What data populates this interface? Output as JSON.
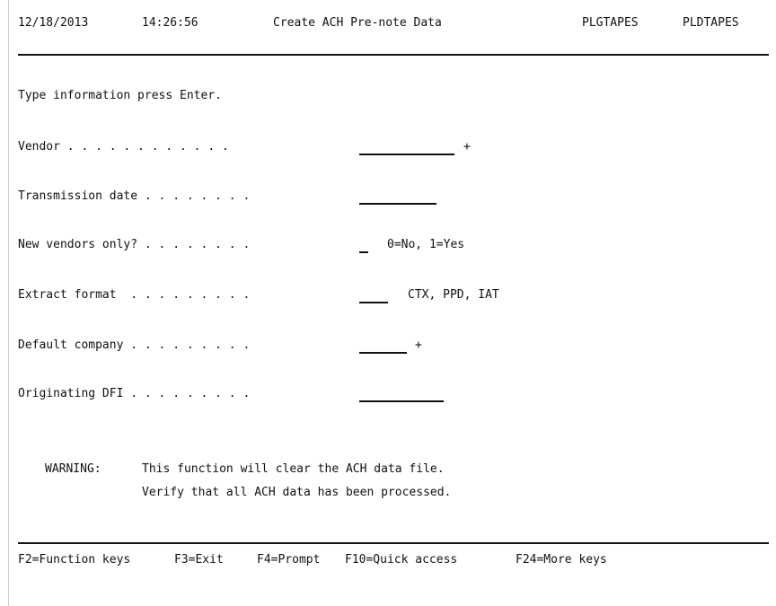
{
  "header": {
    "date": "12/18/2013",
    "time": "14:26:56",
    "title": "Create ACH Pre-note Data",
    "program_id": "PLGTAPES",
    "library_id": "PLDTAPES"
  },
  "instruction": "Type information press Enter.",
  "form": {
    "vendor": {
      "label": "Vendor",
      "dots": " . . . . . . . . . . . .",
      "value": "",
      "prompt_marker": "+"
    },
    "transmission_date": {
      "label": "Transmission date",
      "dots": " . . . . . . . .",
      "value": ""
    },
    "new_vendors_only": {
      "label": "New vendors only?",
      "dots": " . . . . . . . .",
      "value": "",
      "hint": "0=No, 1=Yes"
    },
    "extract_format": {
      "label": "Extract format",
      "dots": "  . . . . . . . . .",
      "value": "",
      "hint": "CTX, PPD, IAT"
    },
    "default_company": {
      "label": "Default company",
      "dots": " . . . . . . . . .",
      "value": "",
      "prompt_marker": "+"
    },
    "originating_dfi": {
      "label": "Originating DFI",
      "dots": " . . . . . . . . .",
      "value": ""
    }
  },
  "warning": {
    "label": "WARNING:",
    "line1": "This function will clear the ACH data file.",
    "line2": "Verify that all ACH data has been processed."
  },
  "function_keys": [
    "F2=Function keys",
    "F3=Exit",
    "F4=Prompt",
    "F10=Quick access",
    "F24=More keys"
  ]
}
